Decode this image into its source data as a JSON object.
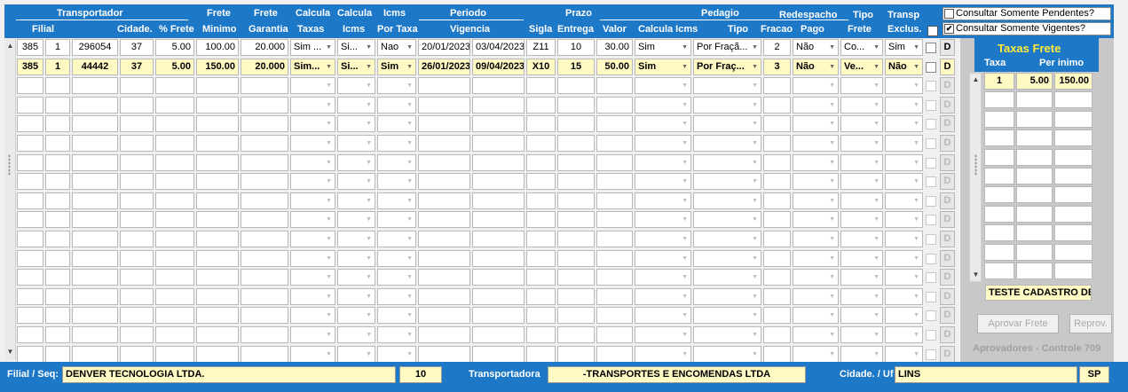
{
  "header": {
    "group_transportador": "Transportador",
    "col_filial": "Filial",
    "col_cidade": "Cidade.",
    "col_pct_frete": "% Frete",
    "col_frete_minimo_1": "Frete",
    "col_frete_minimo_2": "Minimo",
    "col_frete_garantia_1": "Frete",
    "col_frete_garantia_2": "Garantia",
    "col_calc_taxas_1": "Calcula",
    "col_calc_taxas_2": "Taxas",
    "col_calc_icms_1": "Calcula",
    "col_calc_icms_2": "Icms",
    "col_icms_taxa_1": "Icms",
    "col_icms_taxa_2": "Por Taxa",
    "col_periodo_1": "Periodo",
    "col_periodo_2": "Vigencia",
    "col_sigla": "Sigla",
    "col_prazo_1": "Prazo",
    "col_prazo_2": "Entrega",
    "group_pedagio": "Pedagio",
    "col_valor": "Valor",
    "col_calc_icms_ped": "Calcula Icms",
    "col_tipo": "Tipo",
    "col_fracao": "Fracao",
    "col_redespacho_1": "Redespacho",
    "col_redespacho_2": "Pago",
    "col_tipo_frete_1": "Tipo",
    "col_tipo_frete_2": "Frete",
    "col_transp_1": "Transp",
    "col_transp_2": "Exclus."
  },
  "options": {
    "pendentes_label": "Consultar Somente Pendentes?",
    "pendentes_checked": false,
    "vigentes_label": "Consultar Somente Vigentes?",
    "vigentes_mark": "✔"
  },
  "rows": [
    {
      "seq": "385",
      "filial": "1",
      "transp": "296054",
      "cidade": "37",
      "pct": "5.00",
      "minimo": "100.00",
      "garantia": "20.000",
      "calc_taxas": "Sim ...",
      "calc_icms": "Si...",
      "icms_taxa": "Nao",
      "ini": "20/01/2023",
      "fim": "03/04/2023",
      "sigla": "Z11",
      "prazo": "10",
      "ped_valor": "30.00",
      "ped_icms": "Sim",
      "ped_tipo": "Por Fraçã...",
      "fracao": "2",
      "redesp": "Não",
      "tipo_frete": "Co...",
      "exclus": "Sim",
      "d": "D"
    },
    {
      "seq": "385",
      "filial": "1",
      "transp": "44442",
      "cidade": "37",
      "pct": "5.00",
      "minimo": "150.00",
      "garantia": "20.000",
      "calc_taxas": "Sim...",
      "calc_icms": "Si...",
      "icms_taxa": "Sim",
      "ini": "26/01/2023",
      "fim": "09/04/2023",
      "sigla": "X10",
      "prazo": "15",
      "ped_valor": "50.00",
      "ped_icms": "Sim",
      "ped_tipo": "Por Fraç...",
      "fracao": "3",
      "redesp": "Não",
      "tipo_frete": "Ve...",
      "exclus": "Não",
      "d": "D"
    }
  ],
  "empty_row_d": "D",
  "side": {
    "title": "Taxas Frete",
    "col_taxa": "Taxa",
    "col_per_minimo": "Per inimo",
    "rows": [
      {
        "taxa": "1",
        "per": "5.00",
        "minimo": "150.00"
      }
    ],
    "note": "TESTE CADASTRO DE",
    "aprovar": "Aprovar Frete",
    "reprov": "Reprov.",
    "aprovadores": "Aprovadores - Controle 709"
  },
  "footer": {
    "filial_label": "Filial / Seq:",
    "filial_value": "DENVER TECNOLOGIA LTDA.",
    "seq_value": "10",
    "transp_label": "Transportadora",
    "transp_value": "-TRANSPORTES E ENCOMENDAS LTDA",
    "cidade_label": "Cidade. / Uf",
    "cidade_value": "LINS",
    "uf_value": "SP"
  },
  "colors": {
    "header_blue": "#1e78c8",
    "highlight_yellow": "#fff9c4"
  }
}
